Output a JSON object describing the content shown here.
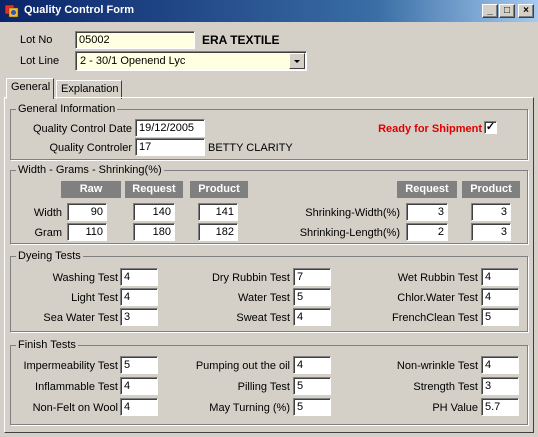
{
  "window": {
    "title": "Quality Control Form",
    "minimize": "_",
    "maximize": "□",
    "close": "×"
  },
  "header": {
    "lot_no_label": "Lot No",
    "lot_no_value": "05002",
    "company": "ERA TEXTILE",
    "lot_line_label": "Lot  Line",
    "lot_line_value": "2 - 30/1 Openend Lyc"
  },
  "tabs": [
    {
      "label": "General"
    },
    {
      "label": "Explanation"
    }
  ],
  "general_info": {
    "title": "General Information",
    "qc_date_label": "Quality Control Date",
    "qc_date_value": "19/12/2005",
    "controller_label": "Quality Controler",
    "controller_value": "17",
    "controller_name": "BETTY CLARITY",
    "ready_label": "Ready for Shipment",
    "ready_checked": "✓"
  },
  "width_grams": {
    "title": "Width - Grams - Shrinking(%)",
    "headers": {
      "raw": "Raw",
      "request": "Request",
      "product": "Product"
    },
    "rows": [
      {
        "label": "Width",
        "raw": "90",
        "request": "140",
        "product": "141"
      },
      {
        "label": "Gram",
        "raw": "110",
        "request": "180",
        "product": "182"
      }
    ],
    "shrink_headers": {
      "request": "Request",
      "product": "Product"
    },
    "shrink_rows": [
      {
        "label": "Shrinking-Width(%)",
        "request": "3",
        "product": "3"
      },
      {
        "label": "Shrinking-Length(%)",
        "request": "2",
        "product": "3"
      }
    ]
  },
  "dyeing": {
    "title": "Dyeing Tests",
    "fields": [
      {
        "label": "Washing Test",
        "value": "4"
      },
      {
        "label": "Light Test",
        "value": "4"
      },
      {
        "label": "Sea Water Test",
        "value": "3"
      },
      {
        "label": "Dry Rubbin Test",
        "value": "7"
      },
      {
        "label": "Water Test",
        "value": "5"
      },
      {
        "label": "Sweat Test",
        "value": "4"
      },
      {
        "label": "Wet Rubbin Test",
        "value": "4"
      },
      {
        "label": "Chlor.Water Test",
        "value": "4"
      },
      {
        "label": "FrenchClean Test",
        "value": "5"
      }
    ]
  },
  "finish": {
    "title": "Finish Tests",
    "fields": [
      {
        "label": "Impermeability Test",
        "value": "5"
      },
      {
        "label": "Inflammable Test",
        "value": "4"
      },
      {
        "label": "Non-Felt on Wool",
        "value": "4"
      },
      {
        "label": "Pumping out the oil",
        "value": "4"
      },
      {
        "label": "Pilling Test",
        "value": "5"
      },
      {
        "label": "May Turning (%)",
        "value": "5"
      },
      {
        "label": "Non-wrinkle Test",
        "value": "4"
      },
      {
        "label": "Strength Test",
        "value": "3"
      },
      {
        "label": "PH Value",
        "value": "5.7"
      }
    ]
  }
}
